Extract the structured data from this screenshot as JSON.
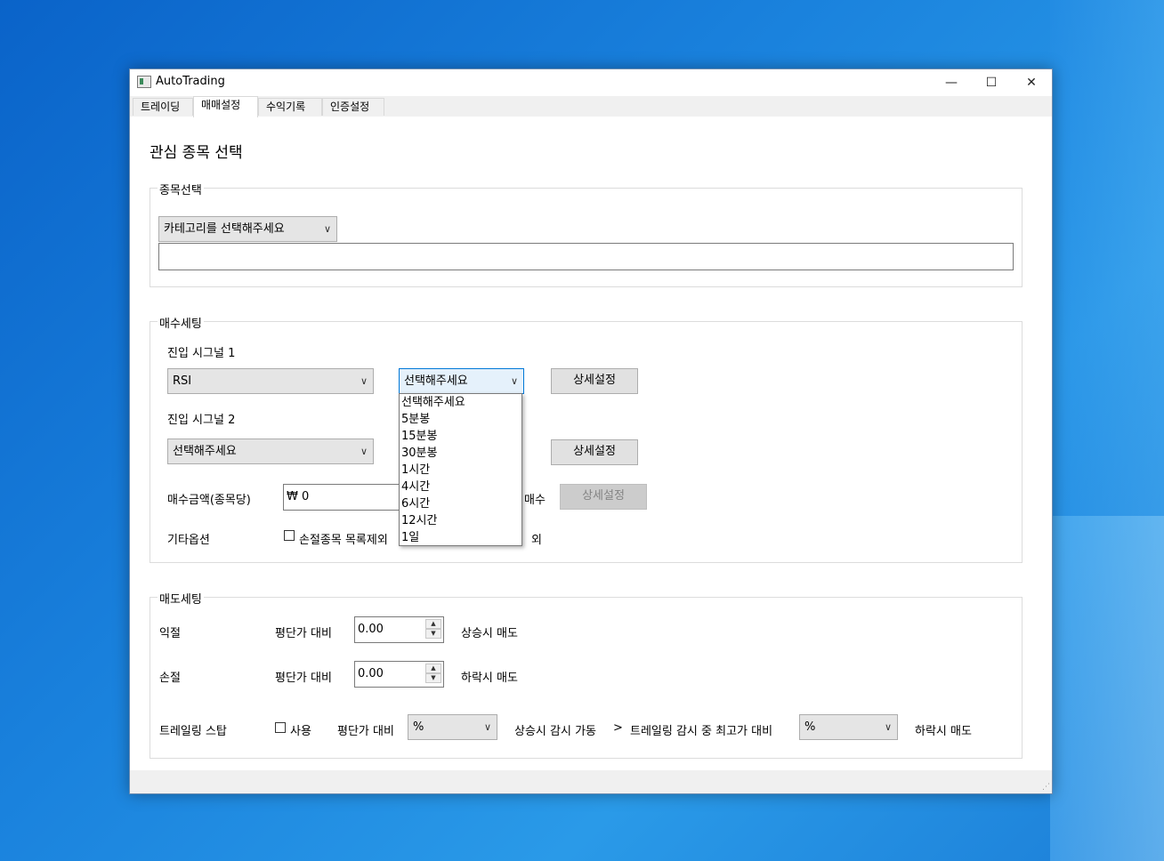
{
  "window": {
    "title": "AutoTrading",
    "controls": {
      "minimize": "—",
      "maximize": "☐",
      "close": "✕"
    }
  },
  "tabs": [
    {
      "label": "트레이딩"
    },
    {
      "label": "매매설정",
      "active": true
    },
    {
      "label": "수익기록"
    },
    {
      "label": "인증설정"
    }
  ],
  "main": {
    "heading": "관심 종목 선택",
    "stock_select": {
      "title": "종목선택",
      "category_combo": "카테고리를 선택해주세요",
      "stock_input": ""
    },
    "buy": {
      "title": "매수세팅",
      "signal1_label": "진입 시그널 1",
      "signal1_combo": "RSI",
      "signal1_interval_combo": "선택해주세요",
      "signal1_detail_button": "상세설정",
      "signal2_label": "진입 시그널 2",
      "signal2_combo": "선택해주세요",
      "signal2_detail_button": "상세설정",
      "amount_label": "매수금액(종목당)",
      "amount_value": "₩ 0",
      "partial_suffix": "매수",
      "amount_detail_button": "상세설정",
      "other_label": "기타옵션",
      "exclude_loss_label": "손절종목 목록제외",
      "exclude_loss_checked": false,
      "other_suffix": "외",
      "interval_options": [
        "선택해주세요",
        "5분봉",
        "15분봉",
        "30분봉",
        "1시간",
        "4시간",
        "6시간",
        "12시간",
        "1일"
      ]
    },
    "sell": {
      "title": "매도세팅",
      "profit_label": "익절",
      "profit_vs": "평단가 대비",
      "profit_value": "0.00",
      "profit_suffix": "상승시 매도",
      "loss_label": "손절",
      "loss_vs": "평단가 대비",
      "loss_value": "0.00",
      "loss_suffix": "하락시 매도",
      "trailing_label": "트레일링 스탑",
      "trailing_use_label": "사용",
      "trailing_use_checked": false,
      "trailing_vs": "평단가 대비",
      "trailing_combo1": "%",
      "trailing_mid": "상승시 감시 가동",
      "trailing_arrow": ">",
      "trailing_watch": "트레일링 감시 중 최고가 대비",
      "trailing_combo2": "%",
      "trailing_suffix": "하락시 매도"
    }
  }
}
